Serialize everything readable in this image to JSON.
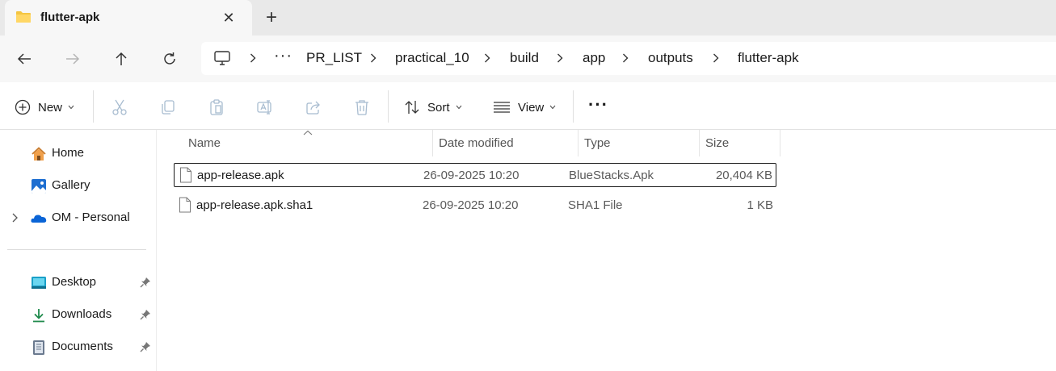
{
  "tab": {
    "title": "flutter-apk",
    "close_symbol": "✕",
    "new_tab_symbol": "+"
  },
  "address": {
    "overflow": "···",
    "crumbs": [
      "PR_LIST",
      "practical_10",
      "build",
      "app",
      "outputs",
      "flutter-apk"
    ]
  },
  "commands": {
    "new_label": "New",
    "sort_label": "Sort",
    "view_label": "View",
    "more_label": "···"
  },
  "sidebar": {
    "items": [
      {
        "label": "Home",
        "icon": "home-icon"
      },
      {
        "label": "Gallery",
        "icon": "gallery-icon"
      },
      {
        "label": "OM - Personal",
        "icon": "onedrive-icon"
      }
    ],
    "pinned": [
      {
        "label": "Desktop",
        "icon": "desktop-icon"
      },
      {
        "label": "Downloads",
        "icon": "downloads-icon"
      },
      {
        "label": "Documents",
        "icon": "documents-icon"
      }
    ]
  },
  "columns": {
    "name": "Name",
    "date": "Date modified",
    "type": "Type",
    "size": "Size"
  },
  "files": [
    {
      "name": "app-release.apk",
      "date": "26-09-2025 10:20",
      "type": "BlueStacks.Apk",
      "size": "20,404 KB",
      "selected": true
    },
    {
      "name": "app-release.apk.sha1",
      "date": "26-09-2025 10:20",
      "type": "SHA1 File",
      "size": "1 KB",
      "selected": false
    }
  ],
  "colors": {
    "accent": "#0067c0",
    "folder": "#f4c542",
    "selection_border": "#1a1a1a"
  }
}
